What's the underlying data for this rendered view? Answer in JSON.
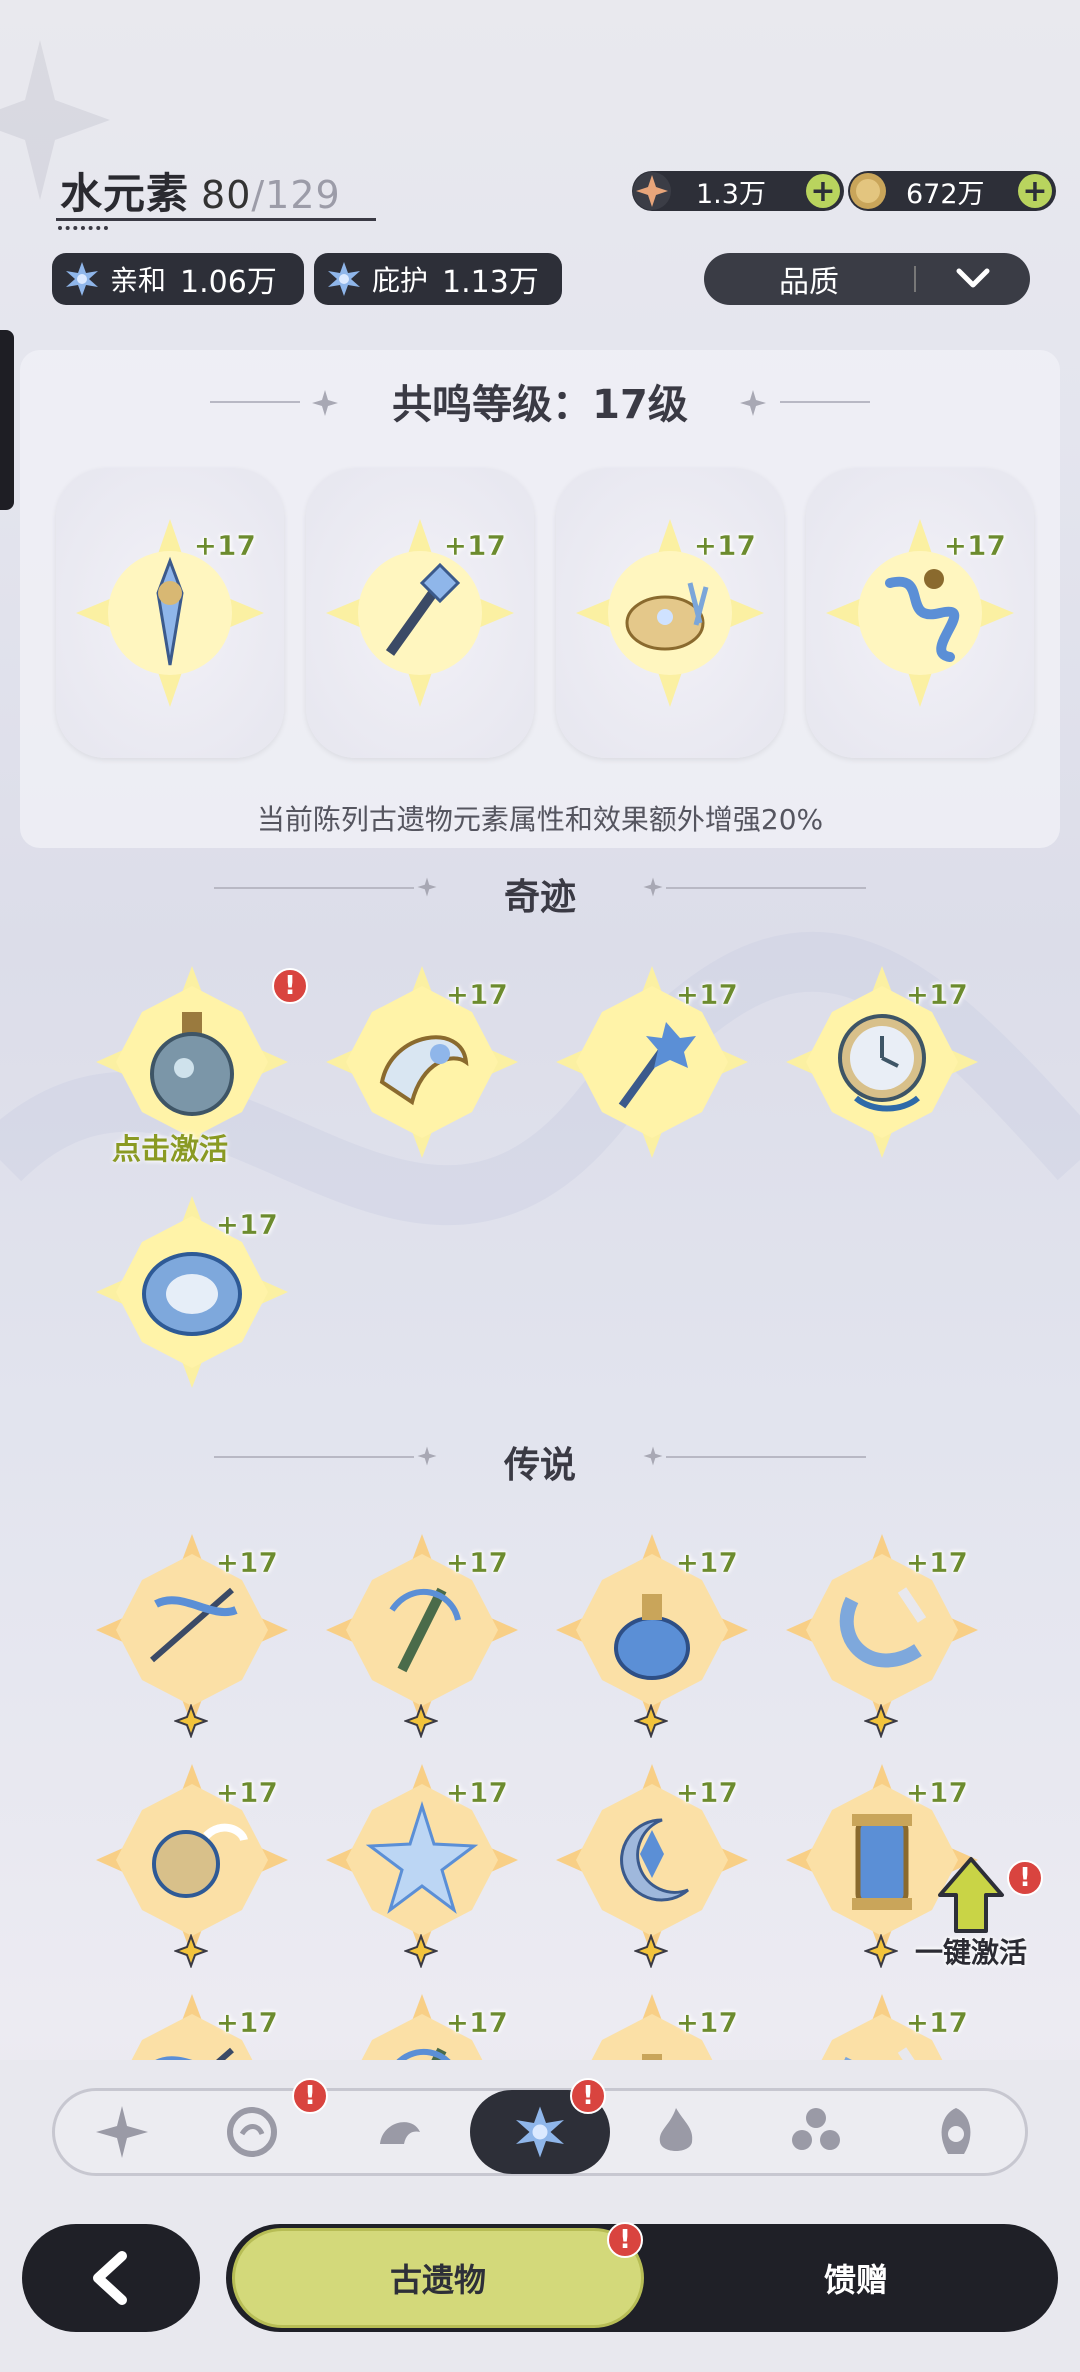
{
  "header": {
    "element_name": "水元素",
    "collected": "80",
    "total_sep": "/129"
  },
  "stats": [
    {
      "label": "亲和",
      "value": "1.06万",
      "icon": "hydro-emblem-icon"
    },
    {
      "label": "庇护",
      "value": "1.13万",
      "icon": "hydro-emblem-icon"
    }
  ],
  "resources": [
    {
      "value": "1.3万",
      "icon": "star-shard-icon",
      "plus": "+"
    },
    {
      "value": "672万",
      "icon": "gold-coin-icon",
      "plus": "+"
    }
  ],
  "sort": {
    "label": "品质",
    "icon": "chevron-down-icon"
  },
  "resonance": {
    "title": "共鸣等级：17级",
    "slots": [
      {
        "level": "+17"
      },
      {
        "level": "+17"
      },
      {
        "level": "+17"
      },
      {
        "level": "+17"
      }
    ],
    "note": "当前陈列古遗物元素属性和效果额外增强20%"
  },
  "sections": {
    "miracle": {
      "title": "奇迹",
      "items": [
        {
          "level": "",
          "action": "点击激活",
          "alert": "!"
        },
        {
          "level": "+17"
        },
        {
          "level": "+17"
        },
        {
          "level": "+17"
        },
        {
          "level": "+17"
        }
      ]
    },
    "legend": {
      "title": "传说",
      "items": [
        {
          "level": "+17"
        },
        {
          "level": "+17"
        },
        {
          "level": "+17"
        },
        {
          "level": "+17"
        },
        {
          "level": "+17"
        },
        {
          "level": "+17"
        },
        {
          "level": "+17"
        },
        {
          "level": "+17"
        },
        {
          "level": "+17"
        },
        {
          "level": "+17"
        },
        {
          "level": "+17"
        },
        {
          "level": "+17"
        }
      ]
    }
  },
  "quick_activate": {
    "label": "一键激活",
    "alert": "!"
  },
  "filters": [
    {
      "icon": "all-star-icon",
      "alert": ""
    },
    {
      "icon": "anemo-icon",
      "alert": "!"
    },
    {
      "icon": "geo-dragon-icon",
      "alert": ""
    },
    {
      "icon": "hydro-icon",
      "alert": "!"
    },
    {
      "icon": "pyro-icon",
      "alert": ""
    },
    {
      "icon": "electro-icon",
      "alert": ""
    },
    {
      "icon": "cryo-icon",
      "alert": ""
    }
  ],
  "bottom_tabs": {
    "back": "back-arrow-icon",
    "relics": "古遗物",
    "relics_alert": "!",
    "gifts": "馈赠"
  },
  "colors": {
    "dark_pill": "#2d2f38",
    "accent_green": "#d3d97a",
    "alert_red": "#d9443f",
    "level_green": "#6c8b2e"
  }
}
